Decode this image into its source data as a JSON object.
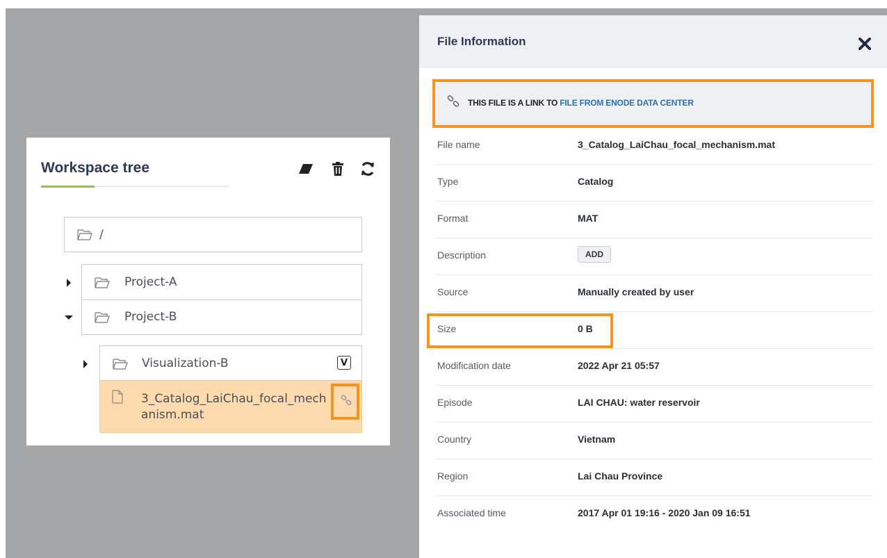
{
  "workspace": {
    "title": "Workspace tree",
    "tools": [
      "eraser-icon",
      "trash-icon",
      "refresh-icon"
    ],
    "root_label": "/",
    "nodes": {
      "project_a": "Project-A",
      "project_b": "Project-B",
      "visualization_b": "Visualization-B",
      "visualization_badge": "V",
      "file": "3_Catalog_LaiChau_focal_mechanism.mat"
    }
  },
  "file_info": {
    "title": "File Information",
    "banner": {
      "prefix": "THIS FILE IS A LINK TO ",
      "link": "FILE FROM ENODE DATA CENTER"
    },
    "rows": [
      {
        "key": "File name",
        "value": "3_Catalog_LaiChau_focal_mechanism.mat"
      },
      {
        "key": "Type",
        "value": "Catalog"
      },
      {
        "key": "Format",
        "value": "MAT"
      },
      {
        "key": "Description",
        "value": "ADD"
      },
      {
        "key": "Source",
        "value": "Manually created by user"
      },
      {
        "key": "Size",
        "value": "0 B"
      },
      {
        "key": "Modification date",
        "value": "2022 Apr 21 05:57"
      },
      {
        "key": "Episode",
        "value": "LAI CHAU: water reservoir"
      },
      {
        "key": "Country",
        "value": "Vietnam"
      },
      {
        "key": "Region",
        "value": "Lai Chau Province"
      },
      {
        "key": "Associated time",
        "value": "2017 Apr 01 19:16 - 2020 Jan 09 16:51"
      }
    ]
  },
  "colors": {
    "highlight": "#f7931e",
    "selected_node": "#fddbae",
    "accent_green": "#8cc63f",
    "link_blue": "#2f6fb0",
    "backdrop": "#a5a6a8"
  }
}
